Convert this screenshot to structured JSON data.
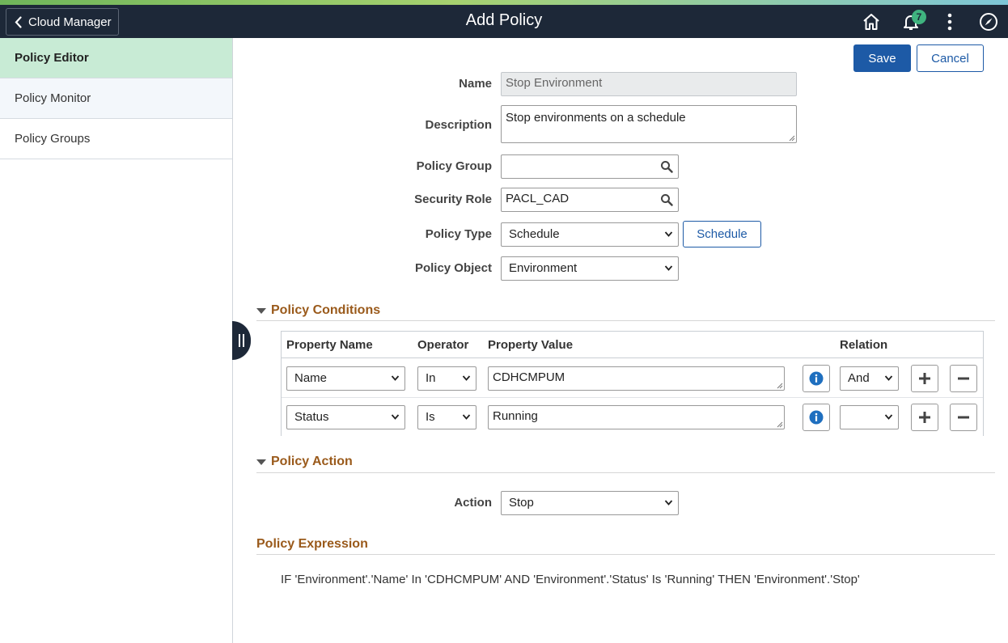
{
  "header": {
    "back_label": "Cloud Manager",
    "title": "Add Policy",
    "notification_count": "7"
  },
  "sidebar": {
    "items": [
      {
        "label": "Policy Editor"
      },
      {
        "label": "Policy Monitor"
      },
      {
        "label": "Policy Groups"
      }
    ]
  },
  "toolbar": {
    "save_label": "Save",
    "cancel_label": "Cancel"
  },
  "form": {
    "name_label": "Name",
    "name_value": "Stop Environment",
    "description_label": "Description",
    "description_value": "Stop environments on a schedule",
    "policy_group_label": "Policy Group",
    "policy_group_value": "",
    "security_role_label": "Security Role",
    "security_role_value": "PACL_CAD",
    "policy_type_label": "Policy Type",
    "policy_type_value": "Schedule",
    "schedule_button_label": "Schedule",
    "policy_object_label": "Policy Object",
    "policy_object_value": "Environment"
  },
  "conditions": {
    "title": "Policy Conditions",
    "columns": {
      "property_name": "Property Name",
      "operator": "Operator",
      "property_value": "Property Value",
      "relation": "Relation"
    },
    "rows": [
      {
        "property_name": "Name",
        "operator": "In",
        "property_value": "CDHCMPUM",
        "relation": "And"
      },
      {
        "property_name": "Status",
        "operator": "Is",
        "property_value": "Running",
        "relation": ""
      }
    ]
  },
  "action": {
    "title": "Policy Action",
    "label": "Action",
    "value": "Stop"
  },
  "expression": {
    "title": "Policy Expression",
    "text": "IF 'Environment'.'Name' In 'CDHCMPUM' AND 'Environment'.'Status' Is 'Running' THEN 'Environment'.'Stop'"
  },
  "colors": {
    "banner": "#1d2838",
    "primary": "#1d5aa6",
    "active_nav": "#c8ebd5",
    "section_title": "#9a5a1b",
    "badge": "#3fb37f"
  },
  "icons": [
    "chevron-left-icon",
    "home-icon",
    "bell-icon",
    "more-vertical-icon",
    "compass-icon",
    "search-icon",
    "chevron-down-icon",
    "info-icon",
    "plus-icon",
    "minus-icon"
  ]
}
